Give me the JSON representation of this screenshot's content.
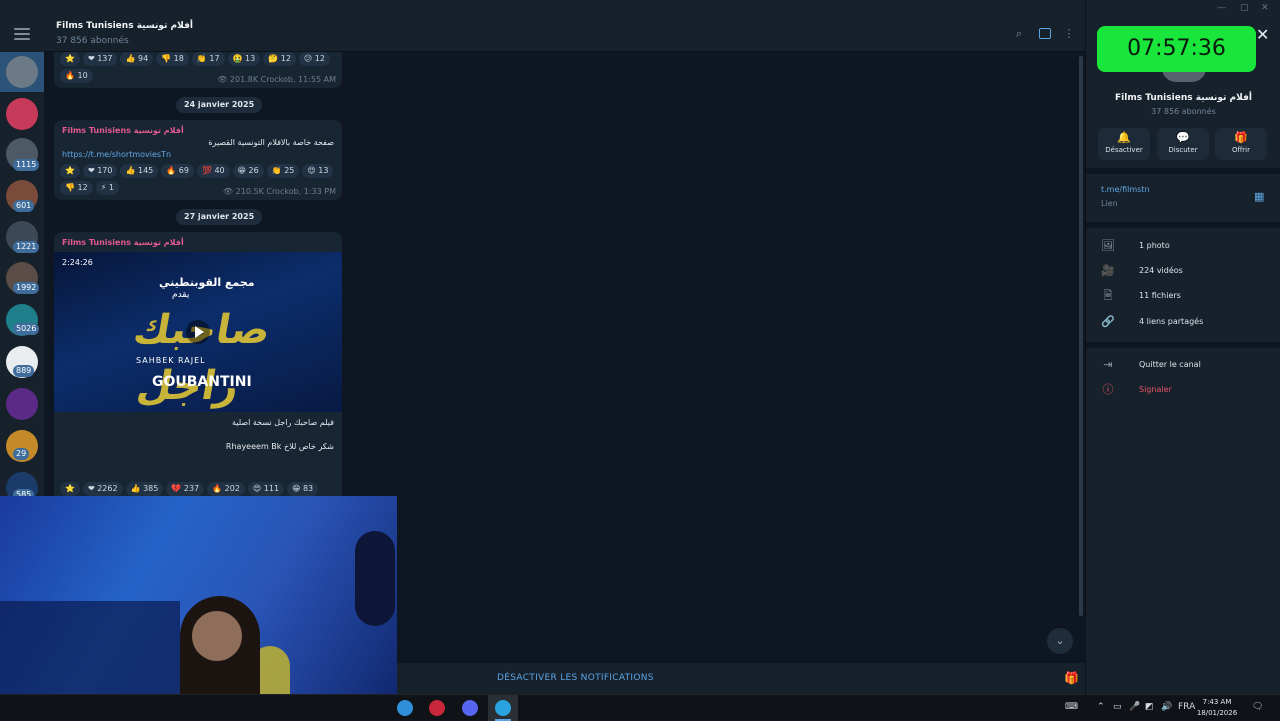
{
  "header": {
    "title": "Films Tunisiens أفلام تونسية",
    "subtitle": "37 856 abonnés"
  },
  "rail": {
    "badges": [
      "1115",
      "601",
      "1221",
      "1992",
      "5026",
      "889",
      "29",
      "585"
    ]
  },
  "messages": [
    {
      "reactions": [
        "⭐",
        "❤ 137",
        "👍 94",
        "👎 18",
        "👏 17",
        "🤮 13",
        "🤔 12",
        "😕 12"
      ],
      "reactions2": [
        "🔥 10"
      ],
      "meta": "👁 201.8K  Crockob, 11:55 AM"
    },
    {
      "date": "24 janvier 2025",
      "sender": "Films Tunisiens أفلام تونسية",
      "text": "صفحة خاصة بالافلام التونسية القصيرة",
      "link": "https://t.me/shortmoviesTn",
      "reactions": [
        "⭐",
        "❤ 170",
        "👍 145",
        "🔥 69",
        "💯 40",
        "😁 26",
        "👏 25",
        "😍 13"
      ],
      "reactions2": [
        "👎 12",
        "⚡ 1"
      ],
      "meta": "👁 210.5K  Crockob, 1:33 PM"
    },
    {
      "date": "27 janvier 2025",
      "sender": "Films Tunisiens أفلام تونسية",
      "video": {
        "duration": "2:24:26",
        "line1": "مجمع القوبنطيني",
        "line2": "يقدم",
        "big": "صاحبك راجل",
        "tag": "SAHBEK RAJEL",
        "brand": "GOUBANTINI"
      },
      "text1": "فيلم صاحبك راجل نسخة اصلية",
      "text2": "شكر خاص للاخ Rhayeeem Bk",
      "reactions": [
        "⭐",
        "❤ 2262",
        "👍 385",
        "💔 237",
        "🔥 202",
        "😍 111",
        "😁 83"
      ]
    }
  ],
  "bottom": {
    "notifications_label": "DÉSACTIVER LES NOTIFICATIONS"
  },
  "panel": {
    "timer": "07:57:36",
    "title": "Films Tunisiens أفلام تونسية",
    "subtitle": "37 856 abonnés",
    "actions": [
      {
        "icon": "bell-icon",
        "glyph": "🔔",
        "label": "Désactiver"
      },
      {
        "icon": "chat-icon",
        "glyph": "💬",
        "label": "Discuter"
      },
      {
        "icon": "gift-icon",
        "glyph": "🎁",
        "label": "Offrir"
      }
    ],
    "link": "t.me/filmstn",
    "link_label": "Lien",
    "media": [
      {
        "icon": "photo-icon",
        "glyph": "🖼",
        "label": "1 photo"
      },
      {
        "icon": "video-icon",
        "glyph": "🎥",
        "label": "224 vidéos"
      },
      {
        "icon": "file-icon",
        "glyph": "🗎",
        "label": "11 fichiers"
      },
      {
        "icon": "link-icon",
        "glyph": "🔗",
        "label": "4 liens partagés"
      }
    ],
    "leave": "Quitter le canal",
    "report": "Signaler"
  },
  "taskbar": {
    "lang": "FRA",
    "time": "7:43 AM",
    "date": "18/01/2026"
  },
  "colors": {
    "accent": "#5ba4e5",
    "timer_bg": "#19e63a",
    "sender": "#e35a8f",
    "danger": "#e6536a"
  }
}
